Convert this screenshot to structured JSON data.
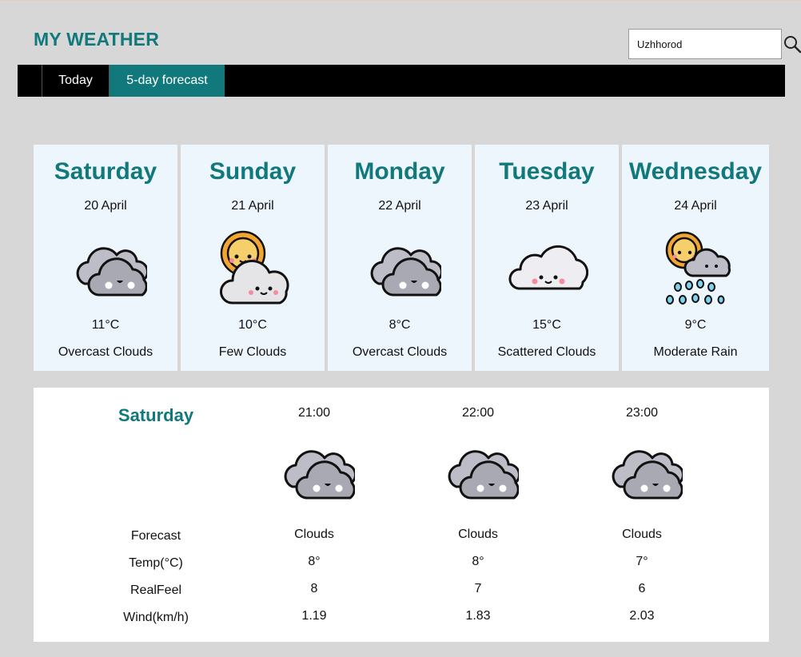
{
  "header": {
    "logo": "MY WEATHER",
    "search": {
      "value": "Uzhhorod",
      "icon": "search-icon"
    }
  },
  "nav": {
    "tabs": [
      {
        "label": "Today"
      },
      {
        "label": "5-day forecast",
        "active": true
      }
    ]
  },
  "days": [
    {
      "name": "Saturday",
      "date": "20 April",
      "temp": "11°C",
      "desc": "Overcast Clouds",
      "icon": "overcast-clouds-icon"
    },
    {
      "name": "Sunday",
      "date": "21 April",
      "temp": "10°C",
      "desc": "Few Clouds",
      "icon": "sun-cloud-icon"
    },
    {
      "name": "Monday",
      "date": "22 April",
      "temp": "8°C",
      "desc": "Overcast Clouds",
      "icon": "overcast-clouds-icon"
    },
    {
      "name": "Tuesday",
      "date": "23 April",
      "temp": "15°C",
      "desc": "Scattered Clouds",
      "icon": "scattered-clouds-icon"
    },
    {
      "name": "Wednesday",
      "date": "24 April",
      "temp": "9°C",
      "desc": "Moderate Rain",
      "icon": "sun-rain-icon"
    }
  ],
  "detail": {
    "day": "Saturday",
    "labels": {
      "forecast": "Forecast",
      "temp": "Temp(°C)",
      "realfeel": "RealFeel",
      "wind": "Wind(km/h)"
    },
    "hours": [
      {
        "time": "21:00",
        "forecast": "Clouds",
        "temp": "8°",
        "realfeel": "8",
        "wind": "1.19",
        "icon": "overcast-clouds-icon"
      },
      {
        "time": "22:00",
        "forecast": "Clouds",
        "temp": "8°",
        "realfeel": "7",
        "wind": "1.83",
        "icon": "overcast-clouds-icon"
      },
      {
        "time": "23:00",
        "forecast": "Clouds",
        "temp": "7°",
        "realfeel": "6",
        "wind": "2.03",
        "icon": "overcast-clouds-icon"
      }
    ]
  },
  "colors": {
    "accent": "#11797b",
    "background": "#d7d7d7",
    "card": "#eef6fd",
    "nav": "#000000"
  }
}
